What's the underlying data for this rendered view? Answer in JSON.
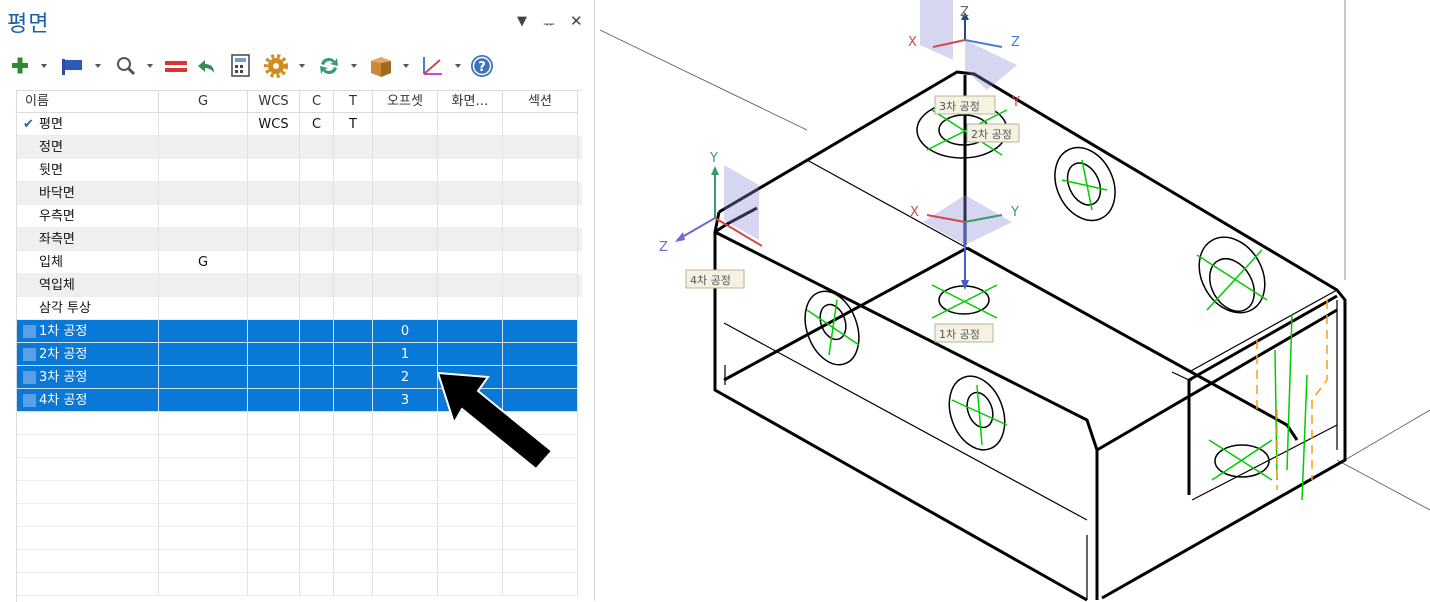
{
  "panel": {
    "title": "평면",
    "buttons": {
      "menu": "▼",
      "pin": "ᅲ",
      "close": "✕"
    }
  },
  "toolbar": {
    "items": [
      "plus-icon",
      "flag-icon",
      "search-icon",
      "equals-icon",
      "undo-icon",
      "calculator-icon",
      "gear-icon",
      "refresh-icon",
      "box-icon",
      "axes-icon",
      "help-icon"
    ]
  },
  "table": {
    "headers": [
      "이름",
      "G",
      "WCS",
      "C",
      "T",
      "오프셋",
      "화면…",
      "섹션"
    ],
    "rows": [
      {
        "name": "평면",
        "g": "",
        "wcs": "WCS",
        "c": "C",
        "t": "T",
        "offset": "",
        "checked": true
      },
      {
        "name": "정면",
        "g": "",
        "wcs": "",
        "c": "",
        "t": "",
        "offset": ""
      },
      {
        "name": "뒷면",
        "g": "",
        "wcs": "",
        "c": "",
        "t": "",
        "offset": ""
      },
      {
        "name": "바닥면",
        "g": "",
        "wcs": "",
        "c": "",
        "t": "",
        "offset": ""
      },
      {
        "name": "우측면",
        "g": "",
        "wcs": "",
        "c": "",
        "t": "",
        "offset": ""
      },
      {
        "name": "좌측면",
        "g": "",
        "wcs": "",
        "c": "",
        "t": "",
        "offset": ""
      },
      {
        "name": "입체",
        "g": "G",
        "wcs": "",
        "c": "",
        "t": "",
        "offset": ""
      },
      {
        "name": "역입체",
        "g": "",
        "wcs": "",
        "c": "",
        "t": "",
        "offset": ""
      },
      {
        "name": "삼각 투상",
        "g": "",
        "wcs": "",
        "c": "",
        "t": "",
        "offset": ""
      },
      {
        "name": "1차 공정",
        "g": "",
        "wcs": "",
        "c": "",
        "t": "",
        "offset": "0",
        "selected": true
      },
      {
        "name": "2차 공정",
        "g": "",
        "wcs": "",
        "c": "",
        "t": "",
        "offset": "1",
        "selected": true
      },
      {
        "name": "3차 공정",
        "g": "",
        "wcs": "",
        "c": "",
        "t": "",
        "offset": "2",
        "selected": true
      },
      {
        "name": "4차 공정",
        "g": "",
        "wcs": "",
        "c": "",
        "t": "",
        "offset": "3",
        "selected": true
      }
    ]
  },
  "viewport": {
    "labels": {
      "op1": "1차 공정",
      "op4": "4차 공정",
      "op2": "2차 공정",
      "op3": "3차 공정"
    },
    "axes": {
      "x": "X",
      "y": "Y",
      "z": "Z"
    }
  },
  "colors": {
    "accent": "#0a78d7",
    "title": "#1f5fa8",
    "green": "#00cc00",
    "orange": "#ff9a1a"
  }
}
